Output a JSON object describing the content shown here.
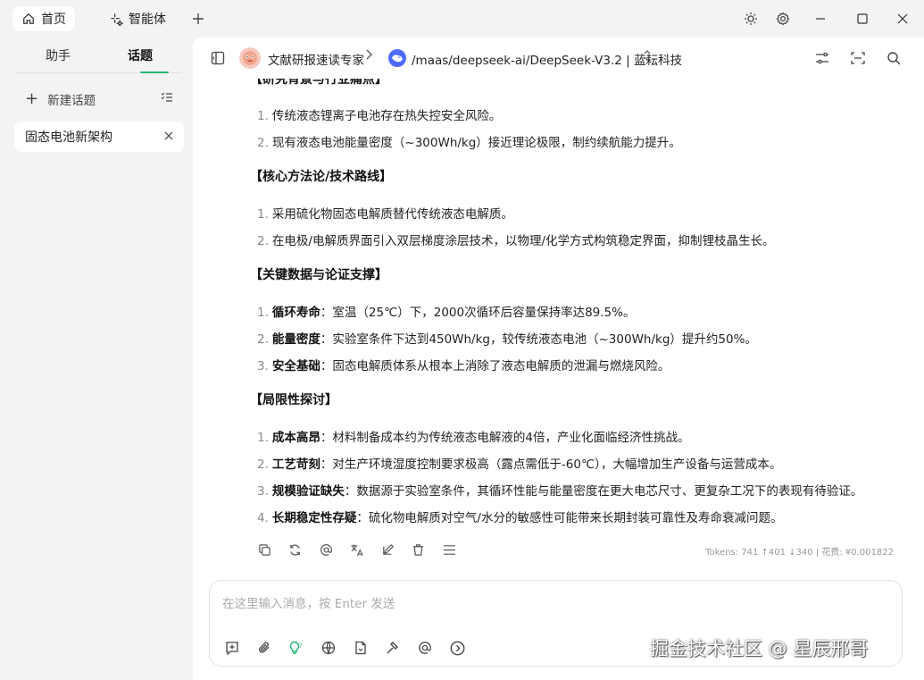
{
  "titlebar": {
    "tabs": [
      {
        "label": "首页",
        "icon": "home-icon"
      },
      {
        "label": "智能体",
        "icon": "sparkle-icon"
      }
    ]
  },
  "sidebar": {
    "tabs": [
      "助手",
      "话题"
    ],
    "new_topic_label": "新建话题",
    "topics": [
      {
        "label": "固态电池新架构"
      }
    ]
  },
  "header": {
    "assistant_name": "文献研报速读专家",
    "model_name": "/maas/deepseek-ai/DeepSeek-V3.2 | 蓝耘科技"
  },
  "message": {
    "clipped_heading": "【研究背景与行业痛点】",
    "background_items": [
      "传统液态锂离子电池存在热失控安全风险。",
      "现有液态电池能量密度（~300Wh/kg）接近理论极限，制约续航能力提升。"
    ],
    "method_heading": "【核心方法论/技术路线】",
    "method_items": [
      "采用硫化物固态电解质替代传统液态电解质。",
      "在电极/电解质界面引入双层梯度涂层技术，以物理/化学方式构筑稳定界面，抑制锂枝晶生长。"
    ],
    "data_heading": "【关键数据与论证支撑】",
    "data_items": [
      {
        "term": "循环寿命",
        "text": "：室温（25℃）下，2000次循环后容量保持率达89.5%。"
      },
      {
        "term": "能量密度",
        "text": "：实验室条件下达到450Wh/kg，较传统液态电池（~300Wh/kg）提升约50%。"
      },
      {
        "term": "安全基础",
        "text": "：固态电解质体系从根本上消除了液态电解质的泄漏与燃烧风险。"
      }
    ],
    "limit_heading": "【局限性探讨】",
    "limit_items": [
      {
        "term": "成本高昂",
        "text": "：材料制备成本约为传统液态电解液的4倍，产业化面临经济性挑战。"
      },
      {
        "term": "工艺苛刻",
        "text": "：对生产环境湿度控制要求极高（露点需低于-60℃），大幅增加生产设备与运营成本。"
      },
      {
        "term": "规模验证缺失",
        "text": "：数据源于实验室条件，其循环性能与能量密度在更大电芯尺寸、更复杂工况下的表现有待验证。"
      },
      {
        "term": "长期稳定性存疑",
        "text": "：硫化物电解质对空气/水分的敏感性可能带来长期封装可靠性及寿命衰减问题。"
      }
    ],
    "tokens": "Tokens: 741 ↑401 ↓340 | 花费: ¥0.001822"
  },
  "input": {
    "placeholder": "在这里输入消息，按 Enter 发送"
  },
  "watermark": "掘金技术社区 @ 星辰邢哥",
  "colors": {
    "accent": "#22b573",
    "model_icon": "#4d6bfe",
    "bulb": "#22b573"
  }
}
